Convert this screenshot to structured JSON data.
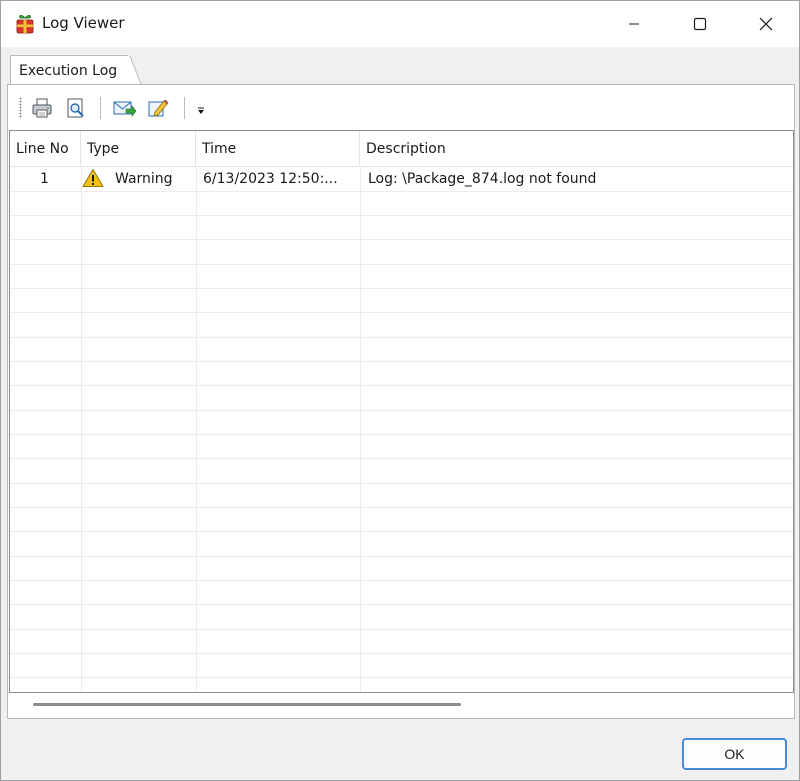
{
  "window": {
    "title": "Log Viewer",
    "controls": {
      "minimize": "minimize-icon",
      "maximize": "maximize-icon",
      "close": "close-icon"
    }
  },
  "tabs": [
    {
      "label": "Execution Log",
      "active": true
    }
  ],
  "toolbar": {
    "buttons": [
      {
        "name": "print",
        "icon": "printer-icon"
      },
      {
        "name": "print-preview",
        "icon": "print-preview-icon"
      },
      {
        "name": "email",
        "icon": "email-send-icon"
      },
      {
        "name": "edit",
        "icon": "edit-pencil-icon"
      }
    ],
    "overflow_icon": "chevron-down-icon"
  },
  "grid": {
    "columns": [
      "Line No",
      "Type",
      "Time",
      "Description"
    ],
    "rows": [
      {
        "line_no": "1",
        "type": "Warning",
        "type_icon": "warning-icon",
        "time": "6/13/2023 12:50:...",
        "description": "Log: \\Package_874.log not found"
      }
    ]
  },
  "buttons": {
    "ok": "OK"
  },
  "colors": {
    "accent": "#4a8ad6",
    "warning": "#f2c21b"
  }
}
